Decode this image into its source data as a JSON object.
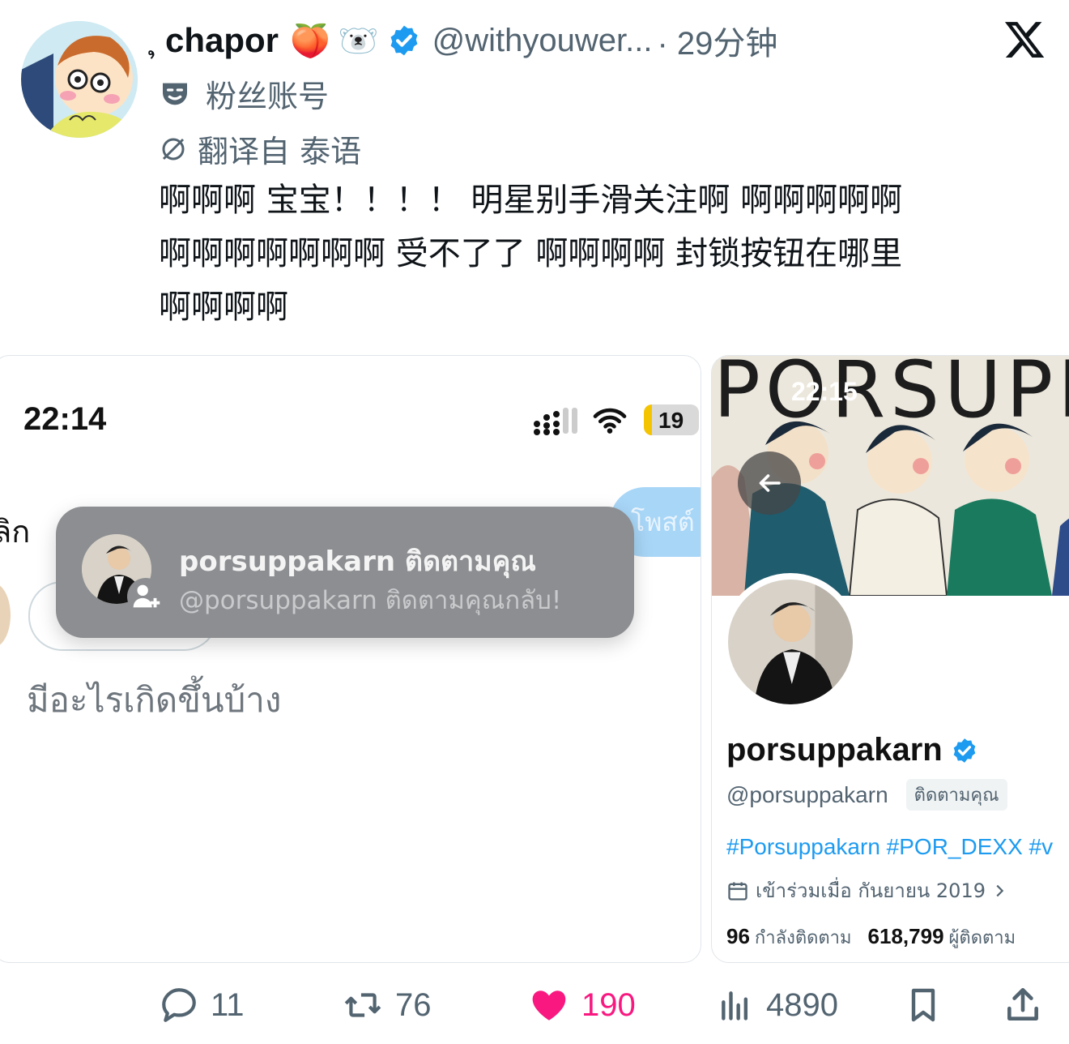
{
  "tweet": {
    "author": {
      "prefix_glyph": "ຸ",
      "display_name": "chapor",
      "emojis": [
        "🍑",
        "🐻‍❄️"
      ],
      "handle": "@withyouwer...",
      "time": "· 29分钟"
    },
    "account_label": "粉丝账号",
    "translate_label": "翻译自 泰语",
    "text_lines": [
      "啊啊啊 宝宝！！！！ 明星别手滑关注啊 啊啊啊啊啊",
      "啊啊啊啊啊啊啊 受不了了 啊啊啊啊 封锁按钮在哪里",
      "啊啊啊啊"
    ]
  },
  "left_shot": {
    "time": "22:14",
    "battery": "19",
    "cancel_label": "ลิก",
    "post_label": "โพสต์",
    "placeholder": "มีอะไรเกิดขึ้นบ้าง",
    "toast": {
      "title": "porsuppakarn ติดตามคุณ",
      "subtitle": "@porsuppakarn ติดตามคุณกลับ!"
    }
  },
  "right_shot": {
    "time": "22:15",
    "banner_text": "PORSUPP",
    "display_name": "porsuppakarn",
    "handle": "@porsuppakarn",
    "follows_you": "ติดตามคุณ",
    "hashtags": "#Porsuppakarn #POR_DEXX #v",
    "joined": "เข้าร่วมเมื่อ กันยายน 2019",
    "following_count": "96",
    "following_label": "กำลังติดตาม",
    "followers_count": "618,799",
    "followers_label": "ผู้ติดตาม"
  },
  "actions": {
    "replies": "11",
    "retweets": "76",
    "likes": "190",
    "views": "4890"
  },
  "colors": {
    "verified": "#1d9bf0",
    "like": "#f91880",
    "muted": "#536471",
    "link": "#1d9bf0"
  }
}
